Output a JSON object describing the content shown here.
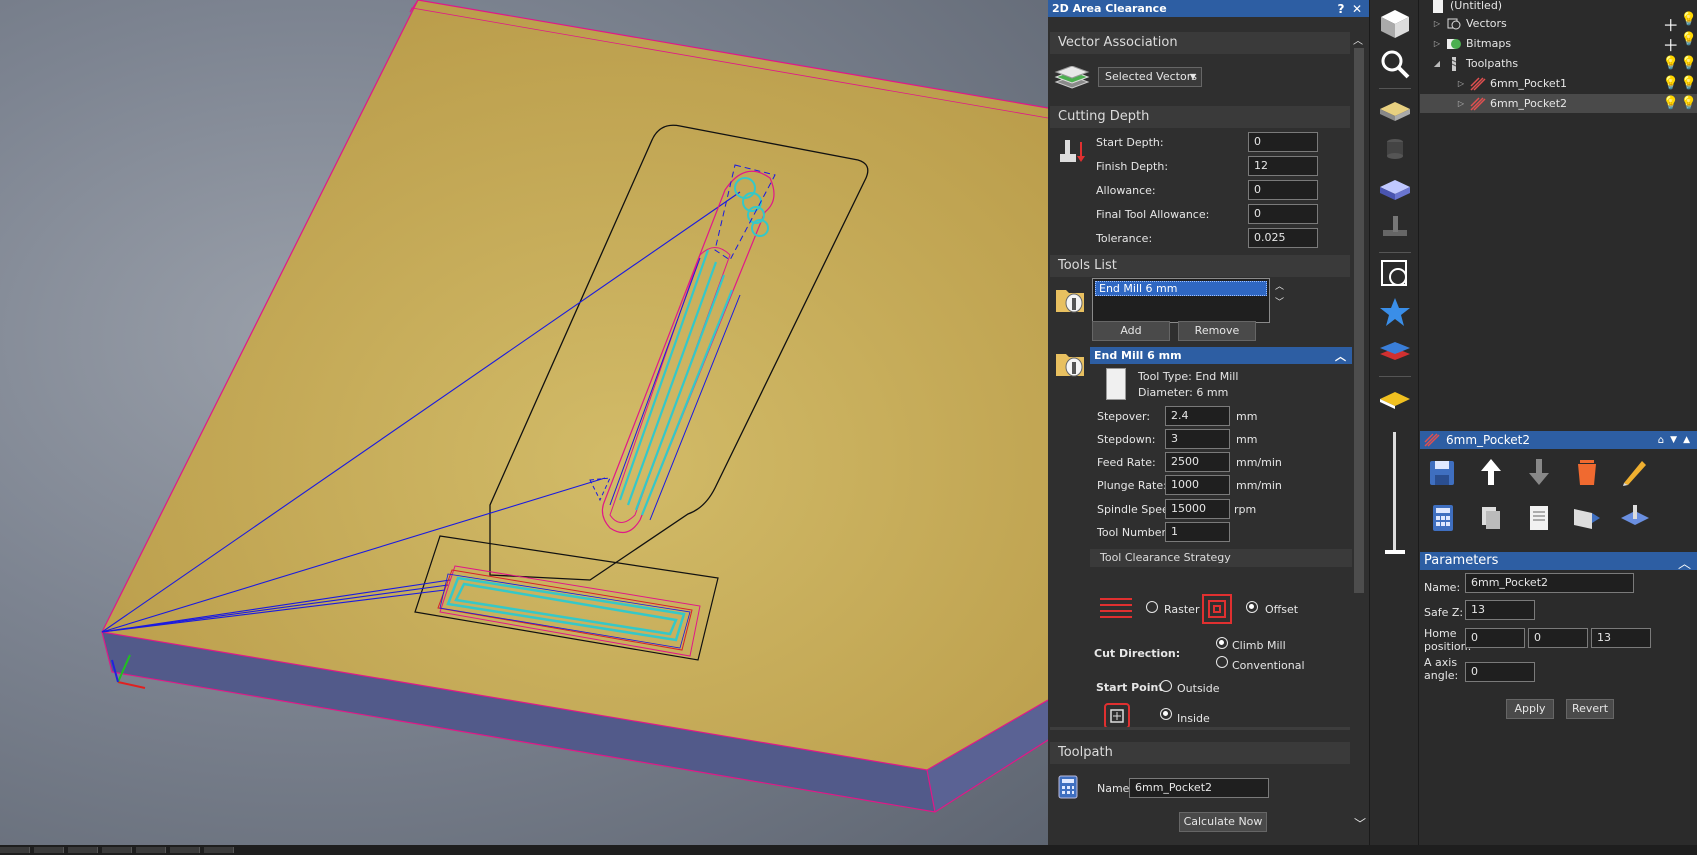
{
  "panel": {
    "title": "2D Area Clearance",
    "help": "?",
    "close": "✕",
    "vector_association": {
      "heading": "Vector Association",
      "selection": "Selected Vectors"
    },
    "cutting_depth": {
      "heading": "Cutting Depth",
      "start_depth_label": "Start Depth:",
      "start_depth": "0",
      "finish_depth_label": "Finish Depth:",
      "finish_depth": "12",
      "allowance_label": "Allowance:",
      "allowance": "0",
      "final_tool_allowance_label": "Final Tool Allowance:",
      "final_tool_allowance": "0",
      "tolerance_label": "Tolerance:",
      "tolerance": "0.025"
    },
    "tools_list": {
      "heading": "Tools List",
      "items": [
        "End Mill 6 mm"
      ],
      "add_label": "Add",
      "remove_label": "Remove"
    },
    "tool": {
      "name": "End Mill 6 mm",
      "tool_type": "Tool Type: End Mill",
      "diameter": "Diameter:  6 mm",
      "stepover_label": "Stepover:",
      "stepover": "2.4",
      "stepover_unit": "mm",
      "stepdown_label": "Stepdown:",
      "stepdown": "3",
      "stepdown_unit": "mm",
      "feed_rate_label": "Feed Rate:",
      "feed_rate": "2500",
      "feed_rate_unit": "mm/min",
      "plunge_rate_label": "Plunge Rate:",
      "plunge_rate": "1000",
      "plunge_rate_unit": "mm/min",
      "spindle_speed_label": "Spindle Speed:",
      "spindle_speed": "15000",
      "spindle_speed_unit": "rpm",
      "tool_number_label": "Tool Number:",
      "tool_number": "1"
    },
    "strategy": {
      "heading": "Tool Clearance Strategy",
      "raster_label": "Raster",
      "offset_label": "Offset",
      "cut_direction_label": "Cut Direction:",
      "climb_label": "Climb Mill",
      "conventional_label": "Conventional",
      "start_point_label": "Start Point:",
      "outside_label": "Outside",
      "inside_label": "Inside"
    },
    "toolpath": {
      "heading": "Toolpath",
      "name_label": "Name:",
      "name": "6mm_Pocket2",
      "calculate_label": "Calculate Now"
    }
  },
  "tree": {
    "root": "(Untitled)",
    "vectors": "Vectors",
    "bitmaps": "Bitmaps",
    "toolpaths": "Toolpaths",
    "pocket1": "6mm_Pocket1",
    "pocket2": "6mm_Pocket2"
  },
  "props": {
    "title": "6mm_Pocket2",
    "parameters_heading": "Parameters",
    "name_label": "Name:",
    "name": "6mm_Pocket2",
    "safez_label": "Safe Z:",
    "safez": "13",
    "home_label_1": "Home",
    "home_label_2": "position:",
    "home_x": "0",
    "home_y": "0",
    "home_z": "13",
    "axis_label_1": "A axis",
    "axis_label_2": "angle:",
    "axis_angle": "0",
    "apply_label": "Apply",
    "revert_label": "Revert"
  },
  "colors": {
    "accent": "#2d5ea3",
    "material_top": "#c4ab5a",
    "material_side": "#525a8a",
    "outline": "#e01888",
    "toolpath_cyan": "#35c8c8",
    "toolpath_blue": "#1a1ae0"
  }
}
